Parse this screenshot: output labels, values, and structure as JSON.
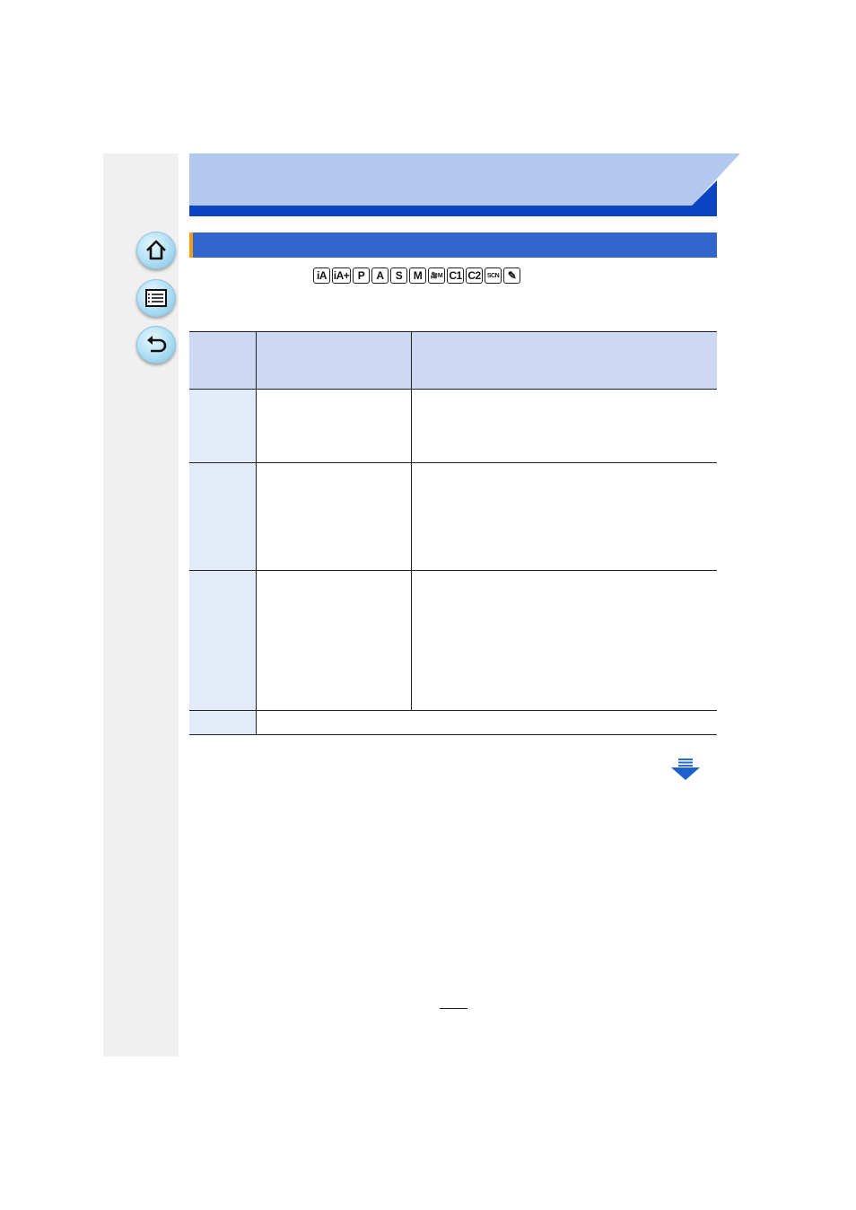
{
  "nav": {
    "home_icon": "home-icon",
    "contents_icon": "contents-list-icon",
    "back_icon": "back-arrow-icon"
  },
  "mode_icons": [
    "iA",
    "iA+",
    "P",
    "A",
    "S",
    "M",
    "🎥M",
    "C1",
    "C2",
    "SCN",
    "✎"
  ],
  "colors": {
    "header_light": "#b3c8ef",
    "header_dark": "#0a44c2",
    "section_bar": "#3366cc",
    "section_accent": "#f39c12",
    "table_header": "#cdd9f3",
    "table_firstcol": "#e3eaf8",
    "sidebar": "#f0f0f0"
  },
  "next_page_icon": "next-page-arrow-icon"
}
